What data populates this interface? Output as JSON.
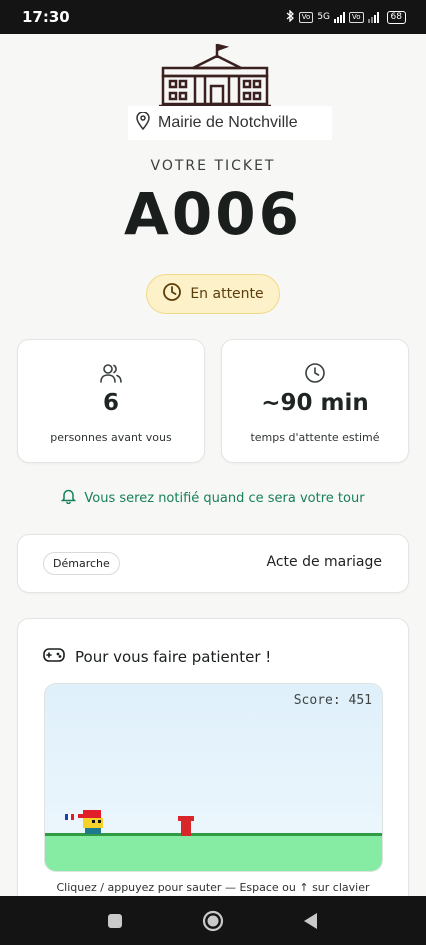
{
  "status_bar": {
    "time": "17:30",
    "network_label": "5G",
    "battery": "68"
  },
  "header": {
    "logo_icon": "town-hall-icon",
    "location_icon": "map-pin-icon",
    "location_name": "Mairie de Notchville"
  },
  "ticket": {
    "label": "VOTRE TICKET",
    "number": "A006",
    "status_icon": "clock-icon",
    "status": "En attente"
  },
  "stats": {
    "people": {
      "icon": "users-icon",
      "value": "6",
      "caption": "personnes avant vous"
    },
    "wait": {
      "icon": "clock-icon",
      "value": "~90 min",
      "caption": "temps d'attente estimé"
    }
  },
  "notification": {
    "icon": "bell-icon",
    "text": "Vous serez notifié quand ce sera votre tour"
  },
  "demarche": {
    "badge": "Démarche",
    "value": "Acte de mariage"
  },
  "game": {
    "icon": "gamepad-icon",
    "title": "Pour vous faire patienter !",
    "score_text": "Score: 451",
    "hint": "Cliquez / appuyez pour sauter — Espace ou ↑ sur clavier"
  },
  "nav": {
    "back_icon": "triangle-back-icon",
    "home_icon": "circle-home-icon",
    "recents_icon": "square-recents-icon"
  },
  "colors": {
    "accent_green": "#17805a",
    "status_pill_bg": "#fdf1c9",
    "ground": "#86eba3"
  }
}
